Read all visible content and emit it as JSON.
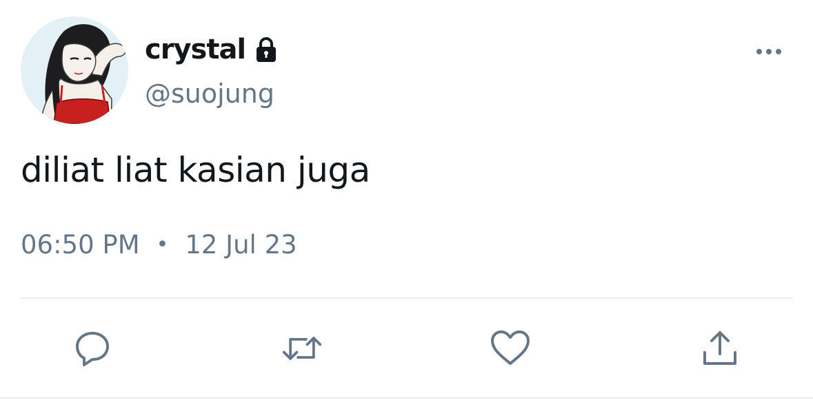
{
  "author": {
    "display_name": "crystal",
    "handle": "@suojung",
    "protected_icon": "lock-icon",
    "avatar": "avatar-illustration"
  },
  "tweet": {
    "text": "diliat liat kasian juga",
    "time": "06:50 PM",
    "separator": "•",
    "date": "12 Jul 23"
  },
  "menu": {
    "icon": "more-icon"
  },
  "actions": [
    {
      "name": "reply",
      "icon": "reply-icon"
    },
    {
      "name": "retweet",
      "icon": "retweet-icon"
    },
    {
      "name": "like",
      "icon": "heart-icon"
    },
    {
      "name": "share",
      "icon": "share-icon"
    }
  ],
  "colors": {
    "text_primary": "#14171a",
    "text_secondary": "#657786",
    "icon": "#657786",
    "divider": "#e6ecf0"
  }
}
